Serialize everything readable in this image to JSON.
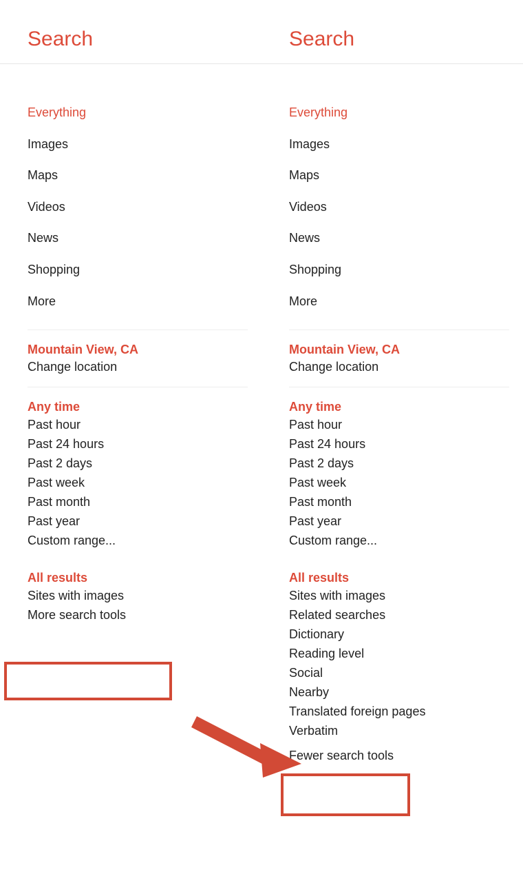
{
  "panels": [
    {
      "title": "Search",
      "categories": [
        {
          "label": "Everything",
          "active": true
        },
        {
          "label": "Images"
        },
        {
          "label": "Maps"
        },
        {
          "label": "Videos"
        },
        {
          "label": "News"
        },
        {
          "label": "Shopping"
        },
        {
          "label": "More"
        }
      ],
      "location": {
        "head": "Mountain View, CA",
        "change": "Change location"
      },
      "time": {
        "head": "Any time",
        "items": [
          "Past hour",
          "Past 24 hours",
          "Past 2 days",
          "Past week",
          "Past month",
          "Past year",
          "Custom range..."
        ]
      },
      "results": {
        "head": "All results",
        "items": [
          "Sites with images",
          "More search tools"
        ]
      },
      "highlight": {
        "type": "box",
        "target": "More search tools"
      }
    },
    {
      "title": "Search",
      "categories": [
        {
          "label": "Everything",
          "active": true
        },
        {
          "label": "Images"
        },
        {
          "label": "Maps"
        },
        {
          "label": "Videos"
        },
        {
          "label": "News"
        },
        {
          "label": "Shopping"
        },
        {
          "label": "More"
        }
      ],
      "location": {
        "head": "Mountain View, CA",
        "change": "Change location"
      },
      "time": {
        "head": "Any time",
        "items": [
          "Past hour",
          "Past 24 hours",
          "Past 2 days",
          "Past week",
          "Past month",
          "Past year",
          "Custom range..."
        ]
      },
      "results": {
        "head": "All results",
        "items": [
          "Sites with images",
          "Related searches",
          "Dictionary",
          "Reading level",
          "Social",
          "Nearby",
          "Translated foreign pages",
          "Verbatim",
          "Fewer search tools"
        ]
      },
      "highlight": {
        "type": "box",
        "target": "Verbatim"
      }
    }
  ],
  "colors": {
    "accent": "#dd4b39",
    "annotation": "#d24a36"
  }
}
